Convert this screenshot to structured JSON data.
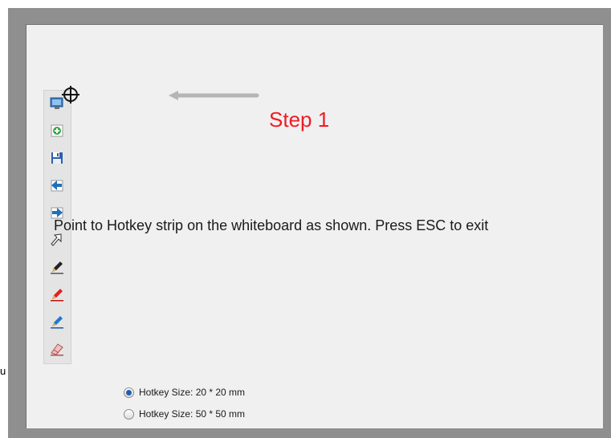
{
  "step_label": "Step 1",
  "instruction": "Point to Hotkey strip on the whiteboard as shown. Press ESC to exit",
  "hotkey_options": [
    {
      "label": "Hotkey Size: 20 * 20 mm",
      "selected": true
    },
    {
      "label": "Hotkey Size: 50 * 50 mm",
      "selected": false
    }
  ],
  "stray_char": "u",
  "hotkey_tools": [
    {
      "name": "display-icon"
    },
    {
      "name": "new-page-icon"
    },
    {
      "name": "save-icon"
    },
    {
      "name": "previous-page-icon"
    },
    {
      "name": "next-page-icon"
    },
    {
      "name": "pointer-icon"
    },
    {
      "name": "black-pen-icon"
    },
    {
      "name": "red-pen-icon"
    },
    {
      "name": "blue-pen-icon"
    },
    {
      "name": "eraser-icon"
    }
  ],
  "colors": {
    "frame": "#8f8f8f",
    "canvas": "#f0f0f0",
    "step_text": "#ee1c24",
    "arrow": "#b5b5b5"
  }
}
